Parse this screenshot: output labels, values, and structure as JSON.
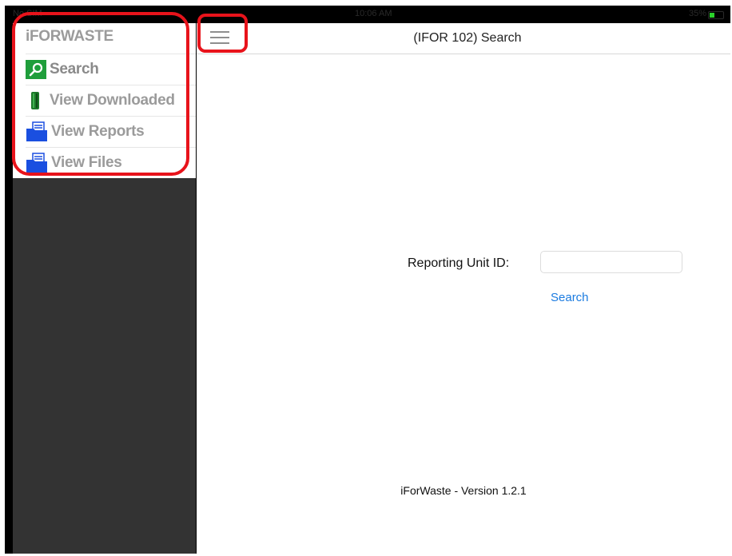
{
  "status_bar": {
    "carrier": "No SIM",
    "time": "10:06 AM",
    "battery": "35%"
  },
  "sidebar": {
    "app_title": "iFORWASTE",
    "items": [
      {
        "label": "Search",
        "icon": "search-icon"
      },
      {
        "label": "View Downloaded",
        "icon": "download-icon"
      },
      {
        "label": "View Reports",
        "icon": "folder-icon"
      },
      {
        "label": "View Files",
        "icon": "folder-icon"
      }
    ]
  },
  "header": {
    "menu_icon": "hamburger-icon",
    "title": "(IFOR 102) Search"
  },
  "form": {
    "field_label": "Reporting Unit ID:",
    "field_value": "",
    "field_placeholder": "",
    "search_label": "Search"
  },
  "footer": {
    "version": "iForWaste - Version 1.2.1"
  },
  "colors": {
    "highlight": "#e8131b",
    "link": "#1b7be0",
    "sidebar_bg": "#333333",
    "search_icon_bg": "#1f9e3b",
    "folder_icon": "#1a4fe0"
  }
}
